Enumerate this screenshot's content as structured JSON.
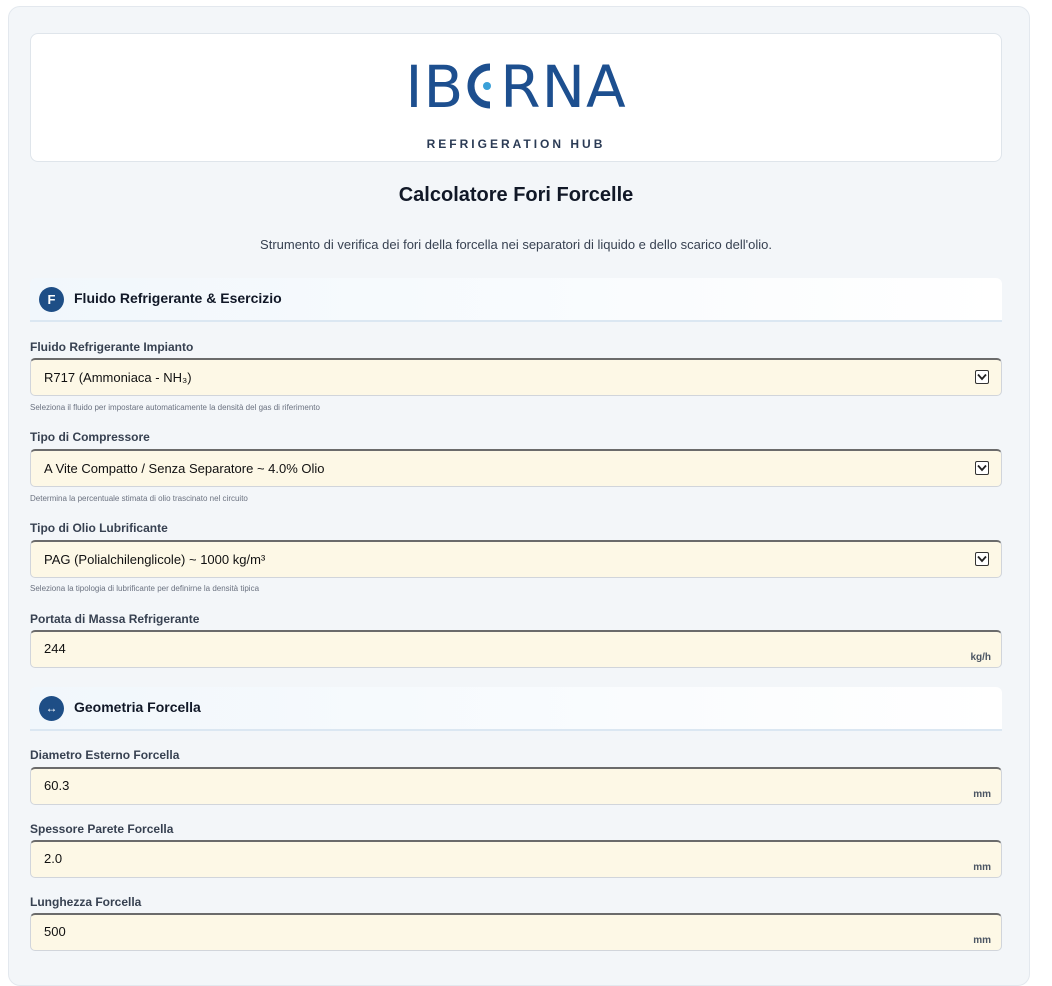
{
  "brand": {
    "logo_text": "IB",
    "logo_text_tail": "RNA",
    "logo_subtitle": "REFRIGERATION HUB"
  },
  "page": {
    "title": "Calcolatore Fori Forcelle",
    "subtitle": "Strumento di verifica dei fori della forcella nei separatori di liquido e dello scarico dell'olio."
  },
  "section_fluid": {
    "badge": "F",
    "title": "Fluido Refrigerante & Esercizio",
    "fields": {
      "refrigerant": {
        "label": "Fluido Refrigerante Impianto",
        "value": "R717 (Ammoniaca - NH₃)",
        "hint": "Seleziona il fluido per impostare automaticamente la densità del gas di riferimento"
      },
      "compressor": {
        "label": "Tipo di Compressore",
        "value": "A Vite Compatto / Senza Separatore ~ 4.0% Olio",
        "hint": "Determina la percentuale stimata di olio trascinato nel circuito"
      },
      "oil": {
        "label": "Tipo di Olio Lubrificante",
        "value": "PAG (Polialchilenglicole) ~ 1000 kg/m³",
        "hint": "Seleziona la tipologia di lubrificante per definirne la densità tipica"
      },
      "mass_flow": {
        "label": "Portata di Massa Refrigerante",
        "value": "244",
        "unit": "kg/h"
      }
    }
  },
  "section_geometry": {
    "badge": "↔",
    "title": "Geometria Forcella",
    "fields": {
      "outer_diameter": {
        "label": "Diametro Esterno Forcella",
        "value": "60.3",
        "unit": "mm"
      },
      "wall_thickness": {
        "label": "Spessore Parete Forcella",
        "value": "2.0",
        "unit": "mm"
      },
      "length": {
        "label": "Lunghezza Forcella",
        "value": "500",
        "unit": "mm"
      }
    }
  },
  "colors": {
    "brand_blue": "#1d4f8f",
    "input_bg": "#fdf8e6",
    "badge_bg": "#1e4e86"
  }
}
